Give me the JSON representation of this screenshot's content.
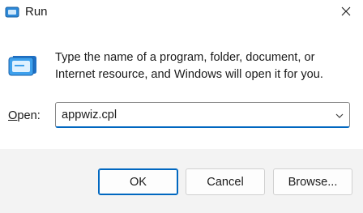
{
  "window": {
    "title": "Run",
    "icon": "run-icon"
  },
  "titlebar": {
    "close_icon": "close-icon"
  },
  "description": "Type the name of a program, folder, document, or Internet resource, and Windows will open it for you.",
  "open_field": {
    "label_accel": "O",
    "label_rest": "pen:",
    "value": "appwiz.cpl",
    "dropdown_icon": "chevron-down-icon"
  },
  "buttons": {
    "ok": "OK",
    "cancel": "Cancel",
    "browse": "Browse..."
  },
  "colors": {
    "accent": "#0067c0",
    "footer_bg": "#f3f3f3"
  }
}
